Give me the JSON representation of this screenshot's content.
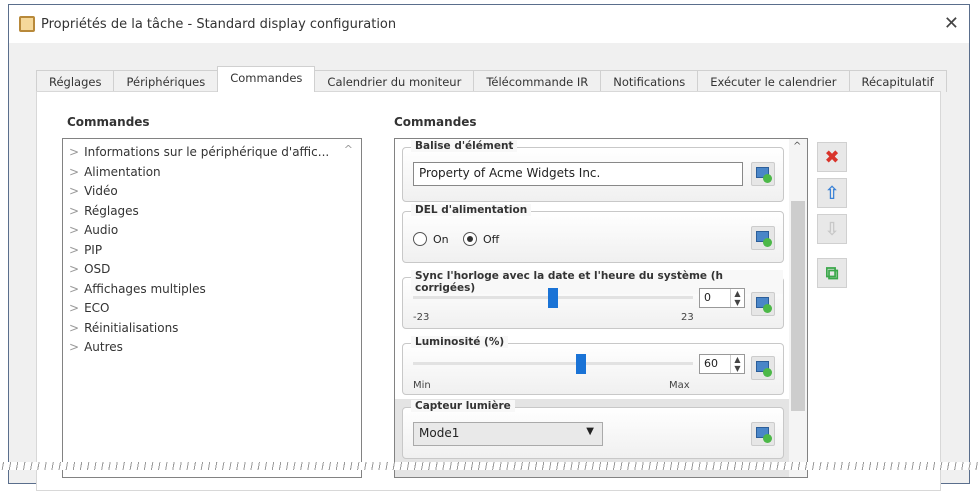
{
  "window": {
    "title": "Propriétés de la tâche - Standard display configuration",
    "close": "✕"
  },
  "tabs": [
    "Réglages",
    "Périphériques",
    "Commandes",
    "Calendrier du moniteur",
    "Télécommande IR",
    "Notifications",
    "Exécuter le calendrier",
    "Récapitulatif"
  ],
  "active_tab": "Commandes",
  "left": {
    "label": "Commandes",
    "items": [
      "Informations sur le périphérique d'affic...",
      "Alimentation",
      "Vidéo",
      "Réglages",
      "Audio",
      "PIP",
      "OSD",
      "Affichages multiples",
      "ECO",
      "Réinitialisations",
      "Autres"
    ]
  },
  "right": {
    "label": "Commandes",
    "balise": {
      "label": "Balise d'élément",
      "value": "Property of Acme Widgets Inc."
    },
    "del": {
      "label": "DEL d'alimentation",
      "on": "On",
      "off": "Off",
      "selected": "Off"
    },
    "sync": {
      "label": "Sync l'horloge avec la date et l'heure du système (h corrigées)",
      "min": "-23",
      "max": "23",
      "value": "0",
      "fraction": 0.5
    },
    "lum": {
      "label": "Luminosité (%)",
      "min": "Min",
      "max": "Max",
      "value": "60",
      "fraction": 0.6
    },
    "capteur": {
      "label": "Capteur lumière",
      "value": "Mode1"
    }
  },
  "colors": {
    "thumb": "#1a73d6",
    "delete": "#d9342b",
    "up": "#3b82d6",
    "copy": "#3aa84a"
  }
}
